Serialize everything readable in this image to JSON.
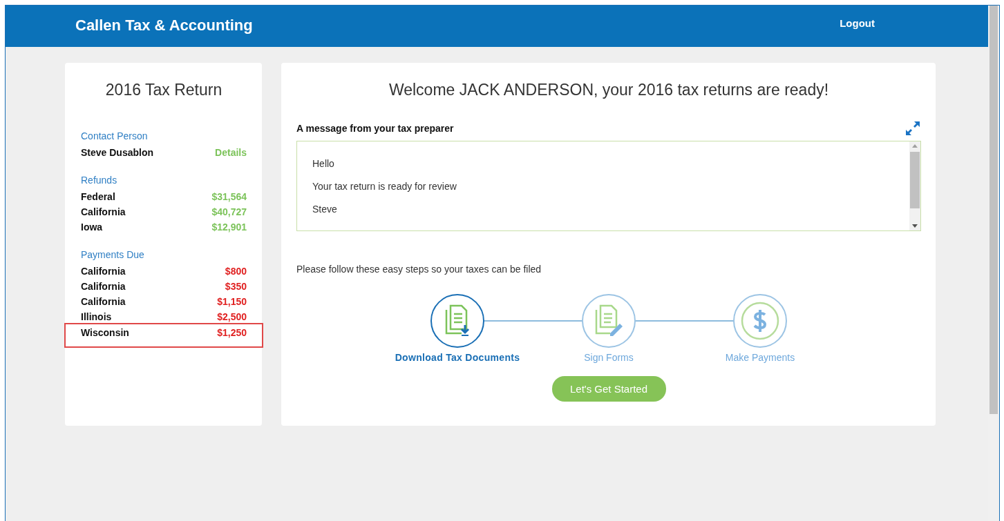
{
  "header": {
    "brand": "Callen Tax & Accounting",
    "logout": "Logout"
  },
  "summary": {
    "title": "2016 Tax Return",
    "contact": {
      "heading": "Contact Person",
      "name": "Steve Dusablon",
      "link": "Details"
    },
    "refunds": {
      "heading": "Refunds",
      "rows": [
        {
          "label": "Federal",
          "amount": "$31,564",
          "highlighted": false
        },
        {
          "label": "California",
          "amount": "$40,727",
          "highlighted": false
        },
        {
          "label": "Iowa",
          "amount": "$12,901",
          "highlighted": false
        }
      ]
    },
    "payments": {
      "heading": "Payments Due",
      "rows": [
        {
          "label": "California",
          "amount": "$800",
          "highlighted": false
        },
        {
          "label": "California",
          "amount": "$350",
          "highlighted": false
        },
        {
          "label": "California",
          "amount": "$1,150",
          "highlighted": false
        },
        {
          "label": "Illinois",
          "amount": "$2,500",
          "highlighted": false
        },
        {
          "label": "Wisconsin",
          "amount": "$1,250",
          "highlighted": true
        }
      ]
    }
  },
  "main": {
    "welcome": "Welcome JACK ANDERSON, your 2016 tax returns are ready!",
    "message": {
      "heading": "A message from your tax preparer",
      "lines": [
        "Hello",
        "Your tax return is ready for review",
        "Steve"
      ]
    },
    "instructions": "Please follow these easy steps so your taxes can be filed",
    "steps": [
      {
        "kind": "download",
        "label": "Download Tax Documents",
        "selected": true
      },
      {
        "kind": "sign",
        "label": "Sign Forms",
        "selected": false
      },
      {
        "kind": "payment",
        "label": "Make Payments",
        "selected": false
      }
    ],
    "cta": "Let's Get Started"
  }
}
